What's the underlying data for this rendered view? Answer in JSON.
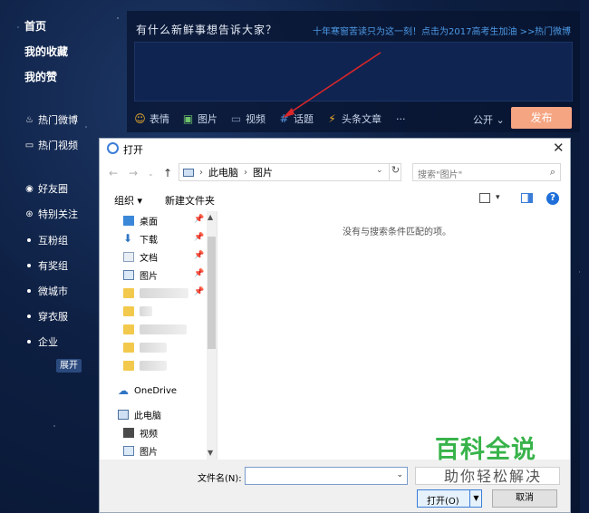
{
  "sidebar": {
    "top_items": [
      {
        "label": "首页"
      },
      {
        "label": "我的收藏"
      },
      {
        "label": "我的赞"
      }
    ],
    "hot_items": [
      {
        "label": "热门微博",
        "icon": "fire-icon"
      },
      {
        "label": "热门视频",
        "icon": "video-icon"
      }
    ],
    "group_items": [
      {
        "label": "好友圈",
        "icon": "circle-icon"
      },
      {
        "label": "特别关注",
        "icon": "star-circle-icon"
      }
    ],
    "dot_items": [
      {
        "label": "互粉组"
      },
      {
        "label": "有奖组"
      },
      {
        "label": "微城市"
      },
      {
        "label": "穿衣服"
      },
      {
        "label": "企业"
      }
    ],
    "expand_label": "展开"
  },
  "publisher": {
    "title": "有什么新鲜事想告诉大家？",
    "promo_link": "十年寒窗苦读只为这一刻！点击为2017高考生加油 >>",
    "hot_link": "热门微博",
    "tools": [
      {
        "label": "表情",
        "icon": "emoji-icon"
      },
      {
        "label": "图片",
        "icon": "image-icon"
      },
      {
        "label": "视频",
        "icon": "video-icon"
      },
      {
        "label": "话题",
        "icon": "hashtag-icon"
      },
      {
        "label": "头条文章",
        "icon": "lightning-icon"
      }
    ],
    "more": "···",
    "visibility": "公开",
    "publish_label": "发布"
  },
  "dialog": {
    "title": "打开",
    "address": {
      "root": "此电脑",
      "current": "图片"
    },
    "search_placeholder": "搜索\"图片\"",
    "toolbar": {
      "organize": "组织 ▾",
      "new_folder": "新建文件夹"
    },
    "nav_items": {
      "desktop": "桌面",
      "downloads": "下载",
      "documents": "文档",
      "pictures": "图片",
      "onedrive": "OneDrive",
      "this_pc": "此电脑",
      "videos": "视频",
      "pc_pictures": "图片"
    },
    "empty_message": "没有与搜索条件匹配的项。",
    "filename_label": "文件名(N):",
    "filename_value": "",
    "open_label": "打开(O)",
    "cancel_label": "取消"
  },
  "watermark": {
    "title": "百科全说",
    "subtitle": "助你轻松解决"
  },
  "colors": {
    "accent_orange": "#f6a582",
    "link_blue": "#4d9ae6",
    "watermark_green": "#38b34a"
  }
}
